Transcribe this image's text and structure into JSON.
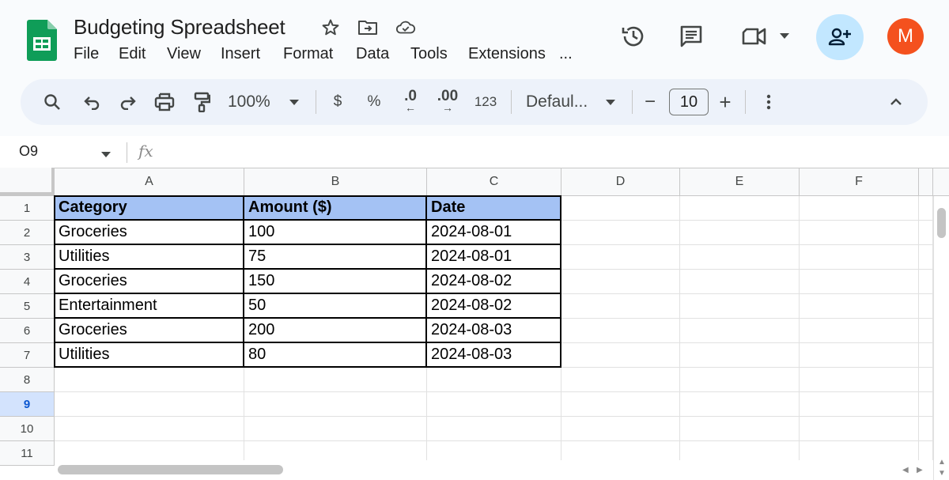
{
  "header": {
    "title": "Budgeting Spreadsheet",
    "menu": [
      "File",
      "Edit",
      "View",
      "Insert",
      "Format",
      "Data",
      "Tools",
      "Extensions",
      "..."
    ],
    "avatar_letter": "M"
  },
  "toolbar": {
    "zoom": "100%",
    "currency": "$",
    "percent": "%",
    "decrease_decimal": ".0",
    "increase_decimal": ".00",
    "number_format": "123",
    "font": "Defaul...",
    "font_size": "10",
    "minus": "−",
    "plus": "+"
  },
  "formula_bar": {
    "name_box": "O9",
    "fx": "fx",
    "formula": ""
  },
  "sheet": {
    "columns": [
      "A",
      "B",
      "C",
      "D",
      "E",
      "F"
    ],
    "rows": [
      "1",
      "2",
      "3",
      "4",
      "5",
      "6",
      "7",
      "8",
      "9",
      "10",
      "11"
    ],
    "active_row": "9",
    "table": [
      [
        "Category",
        "Amount ($)",
        "Date"
      ],
      [
        "Groceries",
        "100",
        "2024-08-01"
      ],
      [
        "Utilities",
        "75",
        "2024-08-01"
      ],
      [
        "Groceries",
        "150",
        "2024-08-02"
      ],
      [
        "Entertainment",
        "50",
        "2024-08-02"
      ],
      [
        "Groceries",
        "200",
        "2024-08-03"
      ],
      [
        "Utilities",
        "80",
        "2024-08-03"
      ]
    ]
  },
  "colors": {
    "header_fill": "#a4c2f4",
    "share_button": "#c2e7ff",
    "avatar": "#f4511e",
    "sheets_green": "#0f9d58"
  },
  "icons": {
    "logo": "google-sheets-logo",
    "star": "star-icon",
    "move": "move-to-folder-icon",
    "cloud": "cloud-saved-icon",
    "history": "version-history-icon",
    "comments": "comments-icon",
    "meet": "video-call-icon",
    "share": "share-add-person-icon"
  }
}
